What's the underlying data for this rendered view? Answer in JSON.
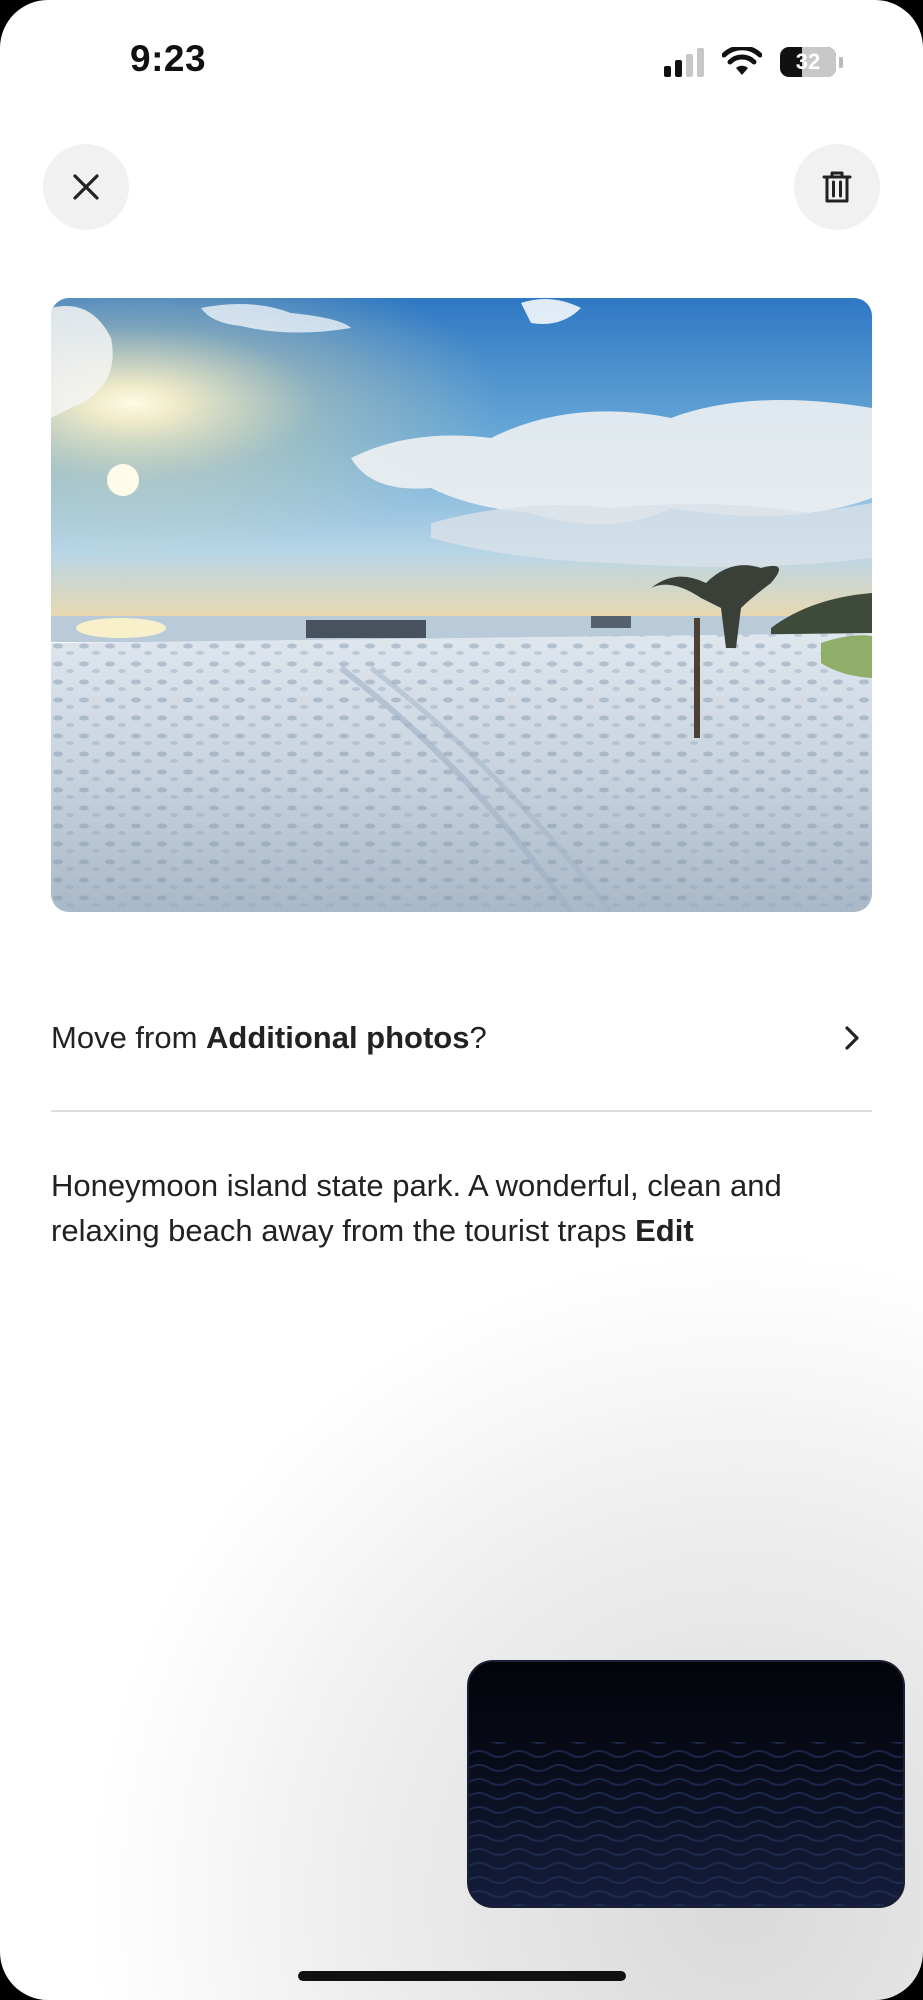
{
  "status_bar": {
    "time": "9:23",
    "battery": "32",
    "icons": [
      "cellular-signal-icon",
      "wifi-icon",
      "battery-icon"
    ]
  },
  "toolbar": {
    "close_icon": "close-icon",
    "delete_icon": "trash-icon"
  },
  "photo": {
    "description_icon": "photo"
  },
  "move_row": {
    "prefix": "Move from ",
    "album": "Additional photos",
    "suffix": "?",
    "chevron_icon": "chevron-right-icon"
  },
  "caption": {
    "text": "Honeymoon island state park. A wonderful, clean and relaxing beach away from the tourist traps ",
    "edit_label": "Edit"
  },
  "colors": {
    "text": "#222222",
    "divider": "#dddddd",
    "button_bg": "#f1f1f1"
  }
}
